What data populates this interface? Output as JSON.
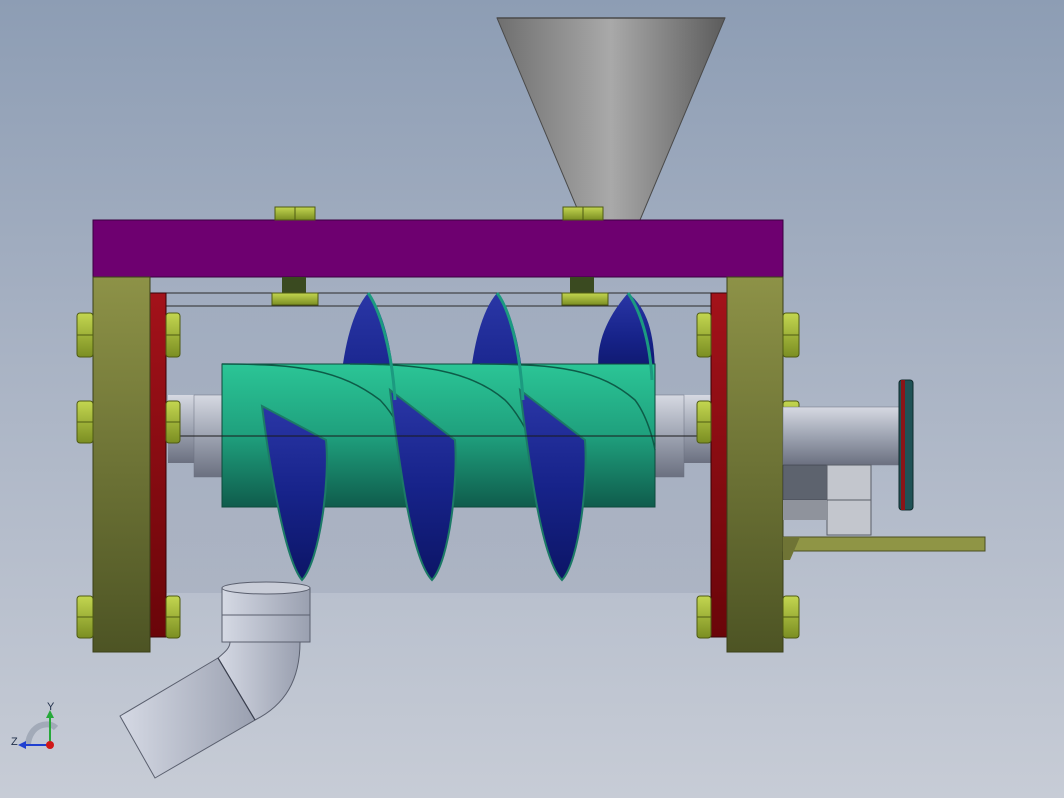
{
  "view": {
    "background_top": "#8d9db4",
    "background_bottom": "#c7ccd6"
  },
  "triad": {
    "y_label": "Y",
    "z_label": "Z",
    "y_color": "#27a83a",
    "z_color": "#2040d0",
    "origin_color": "#d01818"
  },
  "parts": {
    "hopper": {
      "color": "#8a8a8a"
    },
    "top_plate": {
      "color": "#6e0070"
    },
    "end_flanges": {
      "color": "#8a8f43"
    },
    "gaskets": {
      "color": "#8a0b10"
    },
    "screw_shaft": {
      "color": "#1fa481"
    },
    "screw_flights": {
      "color": "#1a2b98"
    },
    "bolts_nuts": {
      "color": "#a9c23a"
    },
    "discharge_elbow": {
      "color": "#b7bccb"
    },
    "drive_shaft": {
      "color": "#9aa0ad"
    },
    "mounting_bracket": {
      "color": "#8f9545"
    },
    "coupling_flange": {
      "color": "#1f5256"
    }
  }
}
